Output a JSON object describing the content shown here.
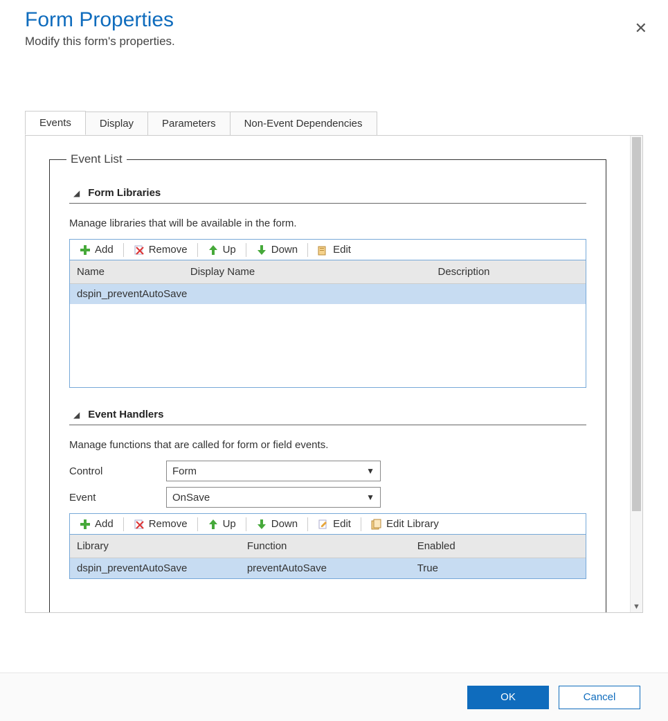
{
  "header": {
    "title": "Form Properties",
    "subtitle": "Modify this form's properties."
  },
  "tabs": [
    {
      "label": "Events",
      "active": true
    },
    {
      "label": "Display",
      "active": false
    },
    {
      "label": "Parameters",
      "active": false
    },
    {
      "label": "Non-Event Dependencies",
      "active": false
    }
  ],
  "event_list_legend": "Event List",
  "form_libraries": {
    "title": "Form Libraries",
    "description": "Manage libraries that will be available in the form.",
    "toolbar": {
      "add": "Add",
      "remove": "Remove",
      "up": "Up",
      "down": "Down",
      "edit": "Edit"
    },
    "columns": {
      "name": "Name",
      "display_name": "Display Name",
      "description": "Description"
    },
    "rows": [
      {
        "name": "dspin_preventAutoSave",
        "display_name": "",
        "description": ""
      }
    ]
  },
  "event_handlers": {
    "title": "Event Handlers",
    "description": "Manage functions that are called for form or field events.",
    "control_label": "Control",
    "control_value": "Form",
    "event_label": "Event",
    "event_value": "OnSave",
    "toolbar": {
      "add": "Add",
      "remove": "Remove",
      "up": "Up",
      "down": "Down",
      "edit": "Edit",
      "edit_library": "Edit Library"
    },
    "columns": {
      "library": "Library",
      "function": "Function",
      "enabled": "Enabled"
    },
    "rows": [
      {
        "library": "dspin_preventAutoSave",
        "function": "preventAutoSave",
        "enabled": "True"
      }
    ]
  },
  "footer": {
    "ok": "OK",
    "cancel": "Cancel"
  }
}
